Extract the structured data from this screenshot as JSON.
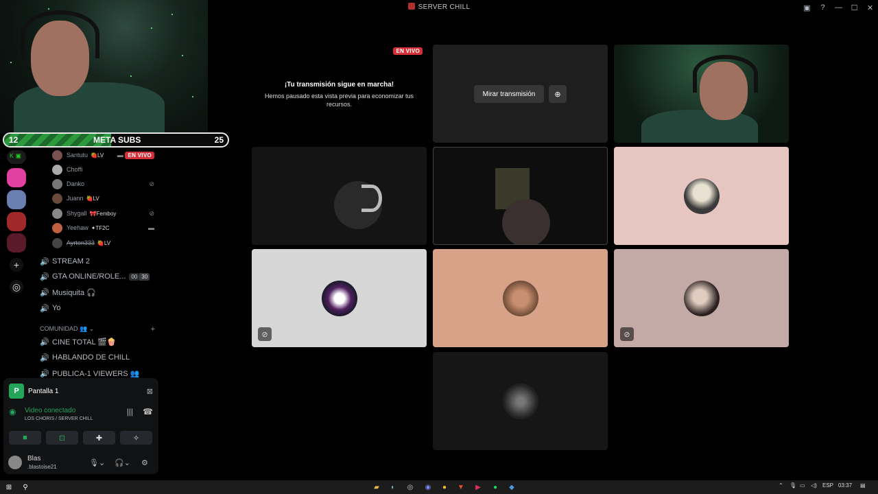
{
  "window": {
    "title": "SERVER CHILL"
  },
  "overlay": {
    "meta_label": "META SUBS",
    "meta_current": "12",
    "meta_goal": "25",
    "meta_progress": 0.48
  },
  "voice_users": [
    {
      "name": "Santutu",
      "tag": "🍓LV",
      "live": "EN VIVO"
    },
    {
      "name": "Choffi",
      "tag": ""
    },
    {
      "name": "Danko",
      "tag": ""
    },
    {
      "name": "Juann",
      "tag": "🍓LV"
    },
    {
      "name": "Shygall",
      "tag": "🎀Femboy"
    },
    {
      "name": "Yeehaw",
      "tag": "✦TF2C"
    },
    {
      "name": "Ayrton333",
      "tag": "🍓LV"
    }
  ],
  "channels": [
    {
      "name": "STREAM 2"
    },
    {
      "name": "GTA ONLINE/ROLE...",
      "count_a": "00",
      "count_b": "30"
    },
    {
      "name": "Musiquita 🎧"
    },
    {
      "name": "Yo"
    }
  ],
  "category": {
    "name": "COMUNIDAD 👥"
  },
  "channels2": [
    {
      "name": "CINE TOTAL 🎬🍿"
    },
    {
      "name": "HABLANDO DE CHILL"
    },
    {
      "name": "PUBLICA-1 VIEWERS 👥"
    }
  ],
  "panel": {
    "screen_label": "Pantalla 1",
    "status": "Video conectado",
    "location": "LOS CHORIS / SERVER CHILL"
  },
  "user": {
    "name": "Blas",
    "handle": ".blastoise21"
  },
  "stage": {
    "live_badge": "EN VIVO",
    "paused_title": "¡Tu transmisión sigue en marcha!",
    "paused_desc": "Hemos pausado esta vista previa para economizar tus recursos.",
    "watch_button": "Mirar transmisión"
  },
  "taskbar": {
    "lang": "ESP",
    "time": "03:37"
  }
}
